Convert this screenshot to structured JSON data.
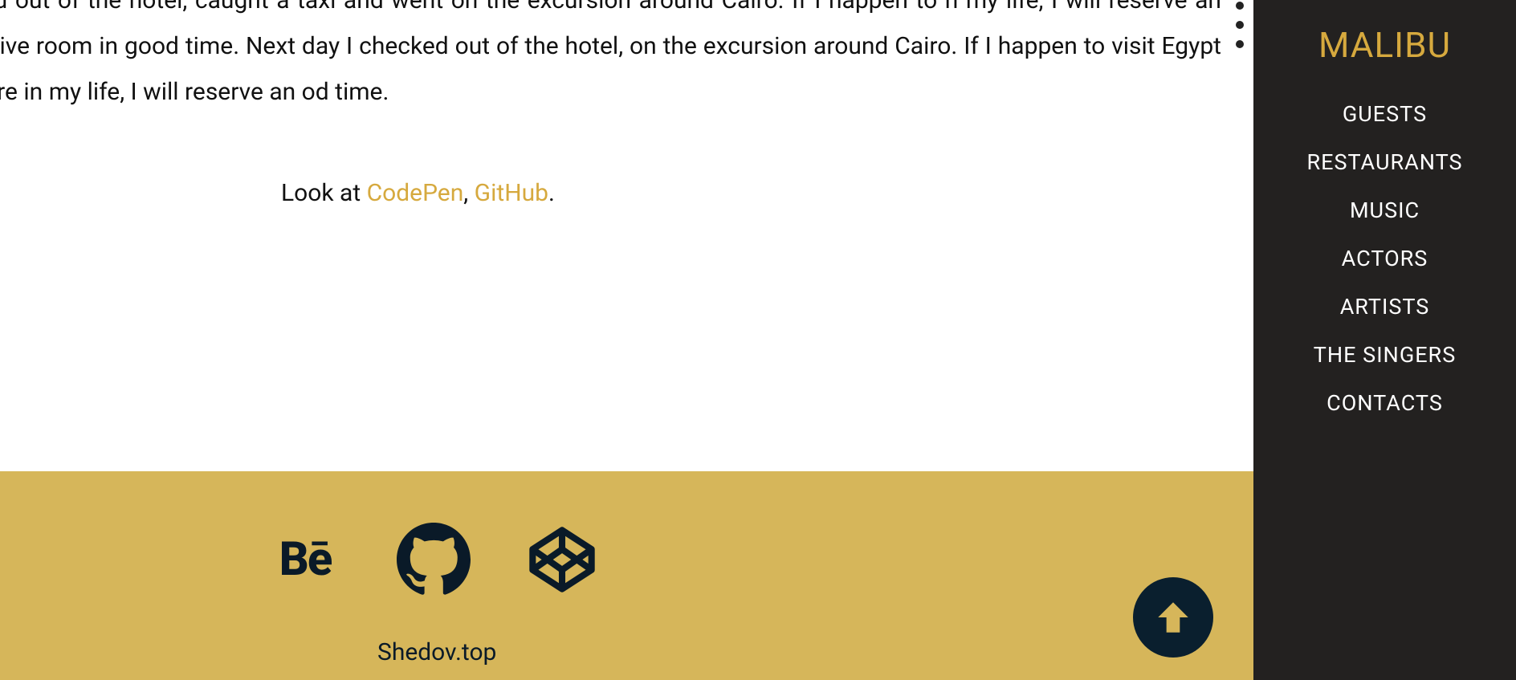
{
  "article": {
    "paragraph": "I checked out of the hotel, caught a taxi and went on the excursion around Cairo. If I happen to n my life, I will reserve an inexpensive room in good time. Next day I checked out of the hotel,  on the excursion around Cairo. If I happen to visit Egypt once more in my life, I will reserve an od time."
  },
  "look": {
    "prefix": "Look at ",
    "codepen": "CodePen",
    "sep": ", ",
    "github": "GitHub",
    "suffix": "."
  },
  "footer": {
    "site": "Shedov.top"
  },
  "sidebar": {
    "brand": "MALIBU",
    "nav": {
      "guests": "GUESTS",
      "restaurants": "RESTAURANTS",
      "music": "MUSIC",
      "actors": "ACTORS",
      "artists": "ARTISTS",
      "singers": "THE SINGERS",
      "contacts": "CONTACTS"
    }
  },
  "icons": {
    "behance": "Bē"
  }
}
